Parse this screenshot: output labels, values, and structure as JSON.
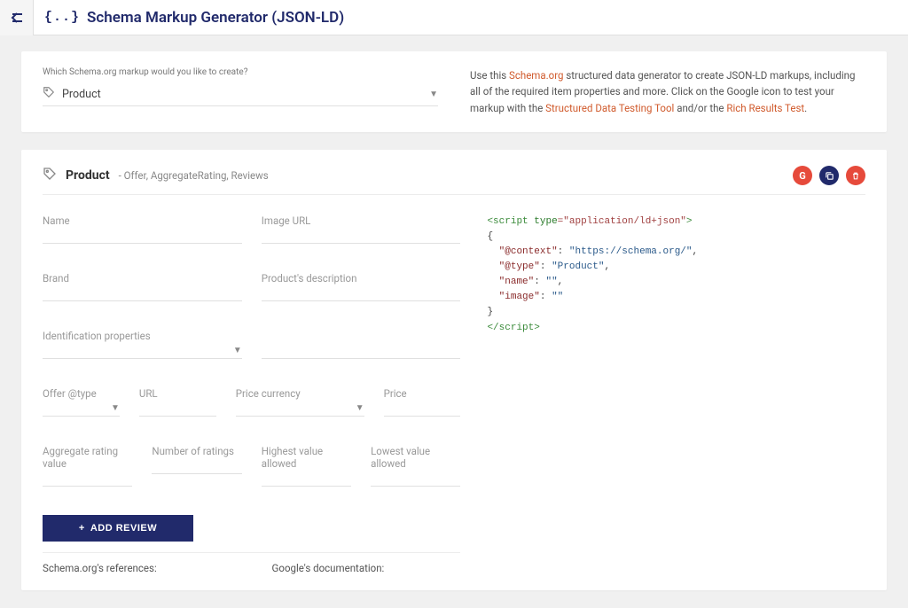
{
  "header": {
    "title": "Schema Markup Generator (JSON-LD)",
    "logo_glyph": "{..}"
  },
  "top": {
    "prompt": "Which Schema.org markup would you like to create?",
    "selected": "Product",
    "desc_prefix": "Use this ",
    "desc_link1": "Schema.org",
    "desc_mid1": " structured data generator to create JSON-LD markups, including all of the required item properties and more. Click on the Google icon to test your markup with the ",
    "desc_link2": "Structured Data Testing Tool",
    "desc_mid2": " and/or the ",
    "desc_link3": "Rich Results Test",
    "desc_suffix": "."
  },
  "section": {
    "title": "Product",
    "subtitle": "- Offer, AggregateRating, Reviews"
  },
  "actions": {
    "google": "G",
    "copy_icon": "⧉",
    "delete_icon": "🗑"
  },
  "fields": {
    "name": "Name",
    "image_url": "Image URL",
    "brand": "Brand",
    "description": "Product's description",
    "identification": "Identification properties",
    "offer_type": "Offer @type",
    "url": "URL",
    "price_currency": "Price currency",
    "price": "Price",
    "agg_rating": "Aggregate rating value",
    "num_ratings": "Number of ratings",
    "highest": "Highest value allowed",
    "lowest": "Lowest value allowed"
  },
  "buttons": {
    "add_review": "ADD REVIEW"
  },
  "code": {
    "script_open_a": "<script ",
    "script_open_b": "type",
    "script_open_c": "=\"application/ld+json\"",
    "script_open_d": ">",
    "context_k": "\"@context\"",
    "context_v": "\"https://schema.org/\"",
    "type_k": "\"@type\"",
    "type_v": "\"Product\"",
    "name_k": "\"name\"",
    "name_v": "\"\"",
    "image_k": "\"image\"",
    "image_v": "\"\"",
    "script_close": "</script>"
  },
  "refs": {
    "schema": "Schema.org's references:",
    "google": "Google's documentation:"
  }
}
